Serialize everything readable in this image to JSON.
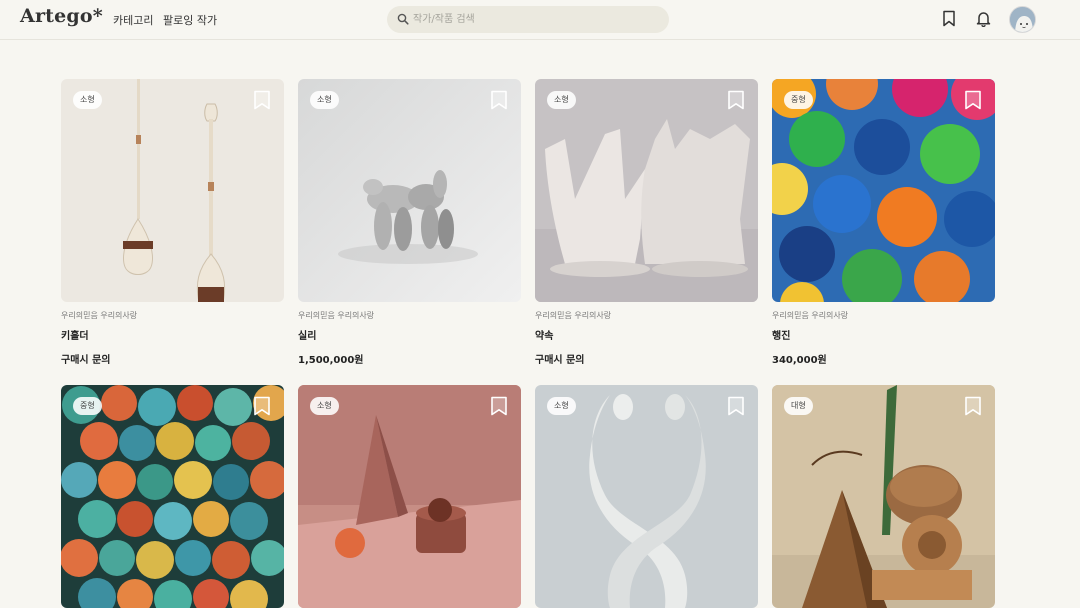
{
  "header": {
    "logo": "Artego*",
    "nav": [
      "카테고리",
      "팔로잉 작가"
    ],
    "search_placeholder": "작가/작품 검색",
    "icons": [
      "bookmark-icon",
      "bell-icon",
      "avatar"
    ]
  },
  "colors": {
    "background": "#f7f6f1",
    "search_bg": "#ebe9df"
  },
  "cards": [
    {
      "size": "소형",
      "artist": "우리의믿음 우리의사랑",
      "title": "키홀더",
      "price": "구매시 문의"
    },
    {
      "size": "소형",
      "artist": "우리의믿음 우리의사랑",
      "title": "실리",
      "price": "1,500,000원"
    },
    {
      "size": "소형",
      "artist": "우리의믿음 우리의사랑",
      "title": "약속",
      "price": "구매시 문의"
    },
    {
      "size": "중형",
      "artist": "우리의믿음 우리의사랑",
      "title": "행진",
      "price": "340,000원"
    },
    {
      "size": "중형",
      "artist": "",
      "title": "",
      "price": ""
    },
    {
      "size": "소형",
      "artist": "",
      "title": "",
      "price": ""
    },
    {
      "size": "소형",
      "artist": "",
      "title": "",
      "price": ""
    },
    {
      "size": "대형",
      "artist": "",
      "title": "",
      "price": ""
    }
  ]
}
